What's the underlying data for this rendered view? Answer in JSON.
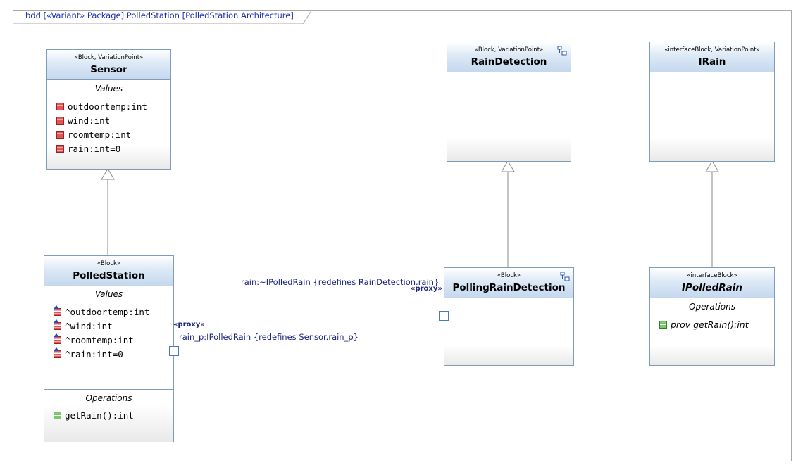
{
  "frame": {
    "title": "bdd [«Variant» Package] PolledStation [PolledStation Architecture]"
  },
  "blocks": {
    "sensor": {
      "stereotype": "«Block, VariationPoint»",
      "name": "Sensor",
      "values_title": "Values",
      "values": [
        "outdoortemp:int",
        "wind:int",
        "roomtemp:int",
        "rain:int=0"
      ]
    },
    "polled_station": {
      "stereotype": "«Block»",
      "name": "PolledStation",
      "values_title": "Values",
      "values": [
        "^outdoortemp:int",
        "^wind:int",
        "^roomtemp:int",
        "^rain:int=0"
      ],
      "operations_title": "Operations",
      "operations": [
        "getRain():int"
      ]
    },
    "rain_detection": {
      "stereotype": "«Block, VariationPoint»",
      "name": "RainDetection"
    },
    "polling_rain_detection": {
      "stereotype": "«Block»",
      "name": "PollingRainDetection"
    },
    "irain": {
      "stereotype": "«interfaceBlock, VariationPoint»",
      "name": "IRain"
    },
    "ipolled_rain": {
      "stereotype": "«interfaceBlock»",
      "name": "IPolledRain",
      "operations_title": "Operations",
      "operations": [
        "prov getRain():int"
      ]
    }
  },
  "ports": {
    "polled_station_port": {
      "stereotype": "«proxy»",
      "label": "rain_p:IPolledRain {redefines Sensor.rain_p}"
    },
    "polling_port": {
      "stereotype": "«proxy»",
      "label": "rain:~IPolledRain {redefines RainDetection.rain}"
    }
  },
  "colors": {
    "block_border": "#7f9db9",
    "header_fill": "#c4d8ee",
    "label_text": "#1a237e",
    "frame_title": "#1a2fb0"
  }
}
